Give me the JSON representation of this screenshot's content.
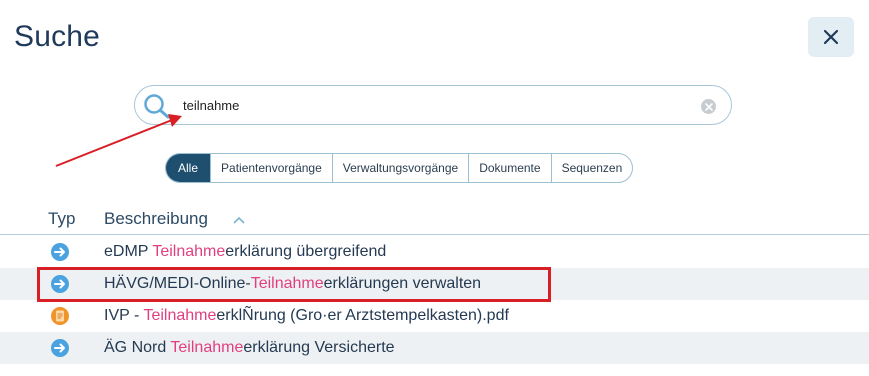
{
  "title": "Suche",
  "search": {
    "value": "teilnahme"
  },
  "filters": [
    "Alle",
    "Patientenvorgänge",
    "Verwaltungsvorgänge",
    "Dokumente",
    "Sequenzen"
  ],
  "table": {
    "headers": {
      "typ": "Typ",
      "description": "Beschreibung"
    },
    "rows": [
      {
        "icon": "arrow-right-icon",
        "pre": "eDMP ",
        "hl": "Teilnahme",
        "post": "erklärung übergreifend"
      },
      {
        "icon": "arrow-right-icon",
        "pre": "HÄVG/MEDI-Online-",
        "hl": "Teilnahme",
        "post": "erklärungen verwalten"
      },
      {
        "icon": "document-icon",
        "pre": "IVP - ",
        "hl": "Teilnahme",
        "post": "erklÑrung (Gro·er Arztstempelkasten).pdf"
      },
      {
        "icon": "arrow-right-icon",
        "pre": "ÄG Nord ",
        "hl": "Teilnahme",
        "post": "erklärung Versicherte"
      }
    ]
  },
  "colors": {
    "accent": "#1e4f6f",
    "highlight_text": "#e0407f",
    "annotation_red": "#d91f26",
    "icon_blue": "#4aa3df",
    "icon_orange": "#f0932b"
  }
}
